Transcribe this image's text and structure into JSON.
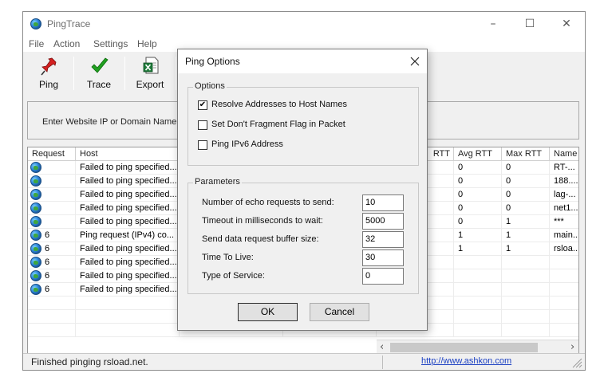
{
  "app": {
    "title": "PingTrace",
    "window_controls": [
      "–",
      "☐",
      "✕"
    ]
  },
  "menu": [
    "File",
    "Action",
    "Settings",
    "Help"
  ],
  "toolbar": {
    "ping": "Ping",
    "trace": "Trace",
    "export": "Export"
  },
  "address_label": "Enter Website IP or Domain Name:",
  "table": {
    "left_columns": [
      "Request",
      "Host"
    ],
    "right_columns": [
      "RTT",
      "Avg RTT",
      "Max RTT",
      "Name"
    ],
    "rows": [
      {
        "request": "",
        "host": "Failed to ping specified...",
        "avg": "0",
        "max": "0",
        "name": "RT-..."
      },
      {
        "request": "",
        "host": "Failed to ping specified...",
        "avg": "0",
        "max": "0",
        "name": "188...."
      },
      {
        "request": "",
        "host": "Failed to ping specified...",
        "avg": "0",
        "max": "0",
        "name": "lag-..."
      },
      {
        "request": "",
        "host": "Failed to ping specified...",
        "avg": "0",
        "max": "0",
        "name": "net1..."
      },
      {
        "request": "",
        "host": "Failed to ping specified...",
        "avg": "0",
        "max": "1",
        "name": "***"
      },
      {
        "request": "6",
        "host": "Ping request (IPv4) co...",
        "avg": "1",
        "max": "1",
        "name": "main..."
      },
      {
        "request": "6",
        "host": "Failed to ping specified...",
        "avg": "1",
        "max": "1",
        "name": "rsloa..."
      },
      {
        "request": "6",
        "host": "Failed to ping specified...",
        "avg": "",
        "max": "",
        "name": ""
      },
      {
        "request": "6",
        "host": "Failed to ping specified...",
        "avg": "",
        "max": "",
        "name": ""
      },
      {
        "request": "6",
        "host": "Failed to ping specified...",
        "avg": "",
        "max": "",
        "name": ""
      }
    ]
  },
  "status": {
    "text": "Finished pinging rsload.net.",
    "link": "http://www.ashkon.com"
  },
  "dialog": {
    "title": "Ping Options",
    "options_group": "Options",
    "options": [
      {
        "label": "Resolve Addresses to Host Names",
        "checked": true
      },
      {
        "label": "Set Don't Fragment Flag in Packet",
        "checked": false
      },
      {
        "label": "Ping IPv6 Address",
        "checked": false
      }
    ],
    "parameters_group": "Parameters",
    "parameters": [
      {
        "label": "Number of echo requests to send:",
        "value": "10"
      },
      {
        "label": "Timeout in milliseconds to wait:",
        "value": "5000"
      },
      {
        "label": "Send data request buffer size:",
        "value": "32"
      },
      {
        "label": "Time To Live:",
        "value": "30"
      },
      {
        "label": "Type of Service:",
        "value": "0"
      }
    ],
    "ok": "OK",
    "cancel": "Cancel"
  }
}
